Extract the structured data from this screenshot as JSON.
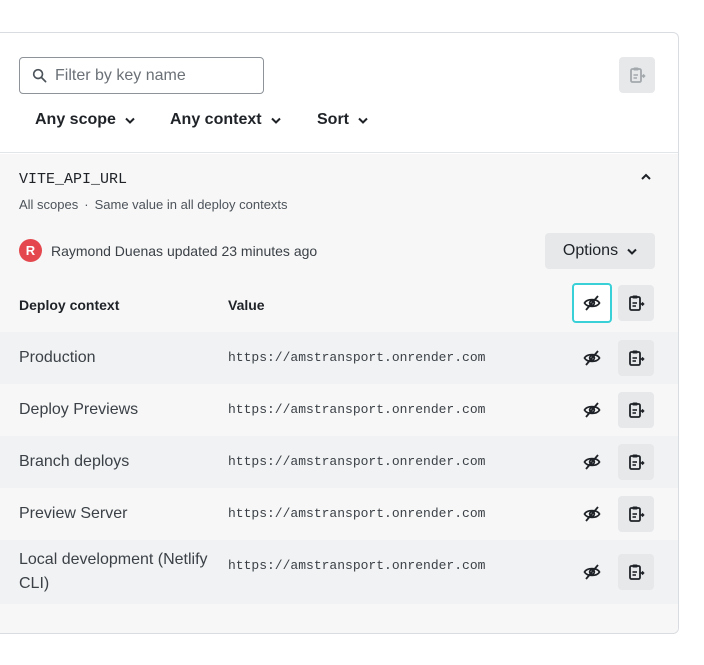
{
  "search": {
    "placeholder": "Filter by key name",
    "value": ""
  },
  "filters": [
    {
      "label": "Any scope"
    },
    {
      "label": "Any context"
    },
    {
      "label": "Sort"
    }
  ],
  "variable": {
    "key": "VITE_API_URL",
    "scopes": "All scopes",
    "value_mode": "Same value in all deploy contexts",
    "avatar_initial": "R",
    "updated_text": "Raymond Duenas updated 23 minutes ago",
    "options_label": "Options",
    "table": {
      "headers": {
        "context": "Deploy context",
        "value": "Value"
      },
      "rows": [
        {
          "context": "Production",
          "value": "https://amstransport.onrender.com"
        },
        {
          "context": "Deploy Previews",
          "value": "https://amstransport.onrender.com"
        },
        {
          "context": "Branch deploys",
          "value": "https://amstransport.onrender.com"
        },
        {
          "context": "Preview Server",
          "value": "https://amstransport.onrender.com"
        },
        {
          "context": "Local development (Netlify CLI)",
          "value": "https://amstransport.onrender.com"
        }
      ]
    }
  },
  "colors": {
    "accent_focus": "#3ad0d8",
    "avatar": "#e4484e",
    "button_bg": "#e6e8ea"
  },
  "icons": {
    "search": "search-icon",
    "copy": "clipboard-copy-icon",
    "hide": "eye-slash-icon",
    "chevron_down": "chevron-down-icon",
    "chevron_up": "chevron-up-icon"
  }
}
